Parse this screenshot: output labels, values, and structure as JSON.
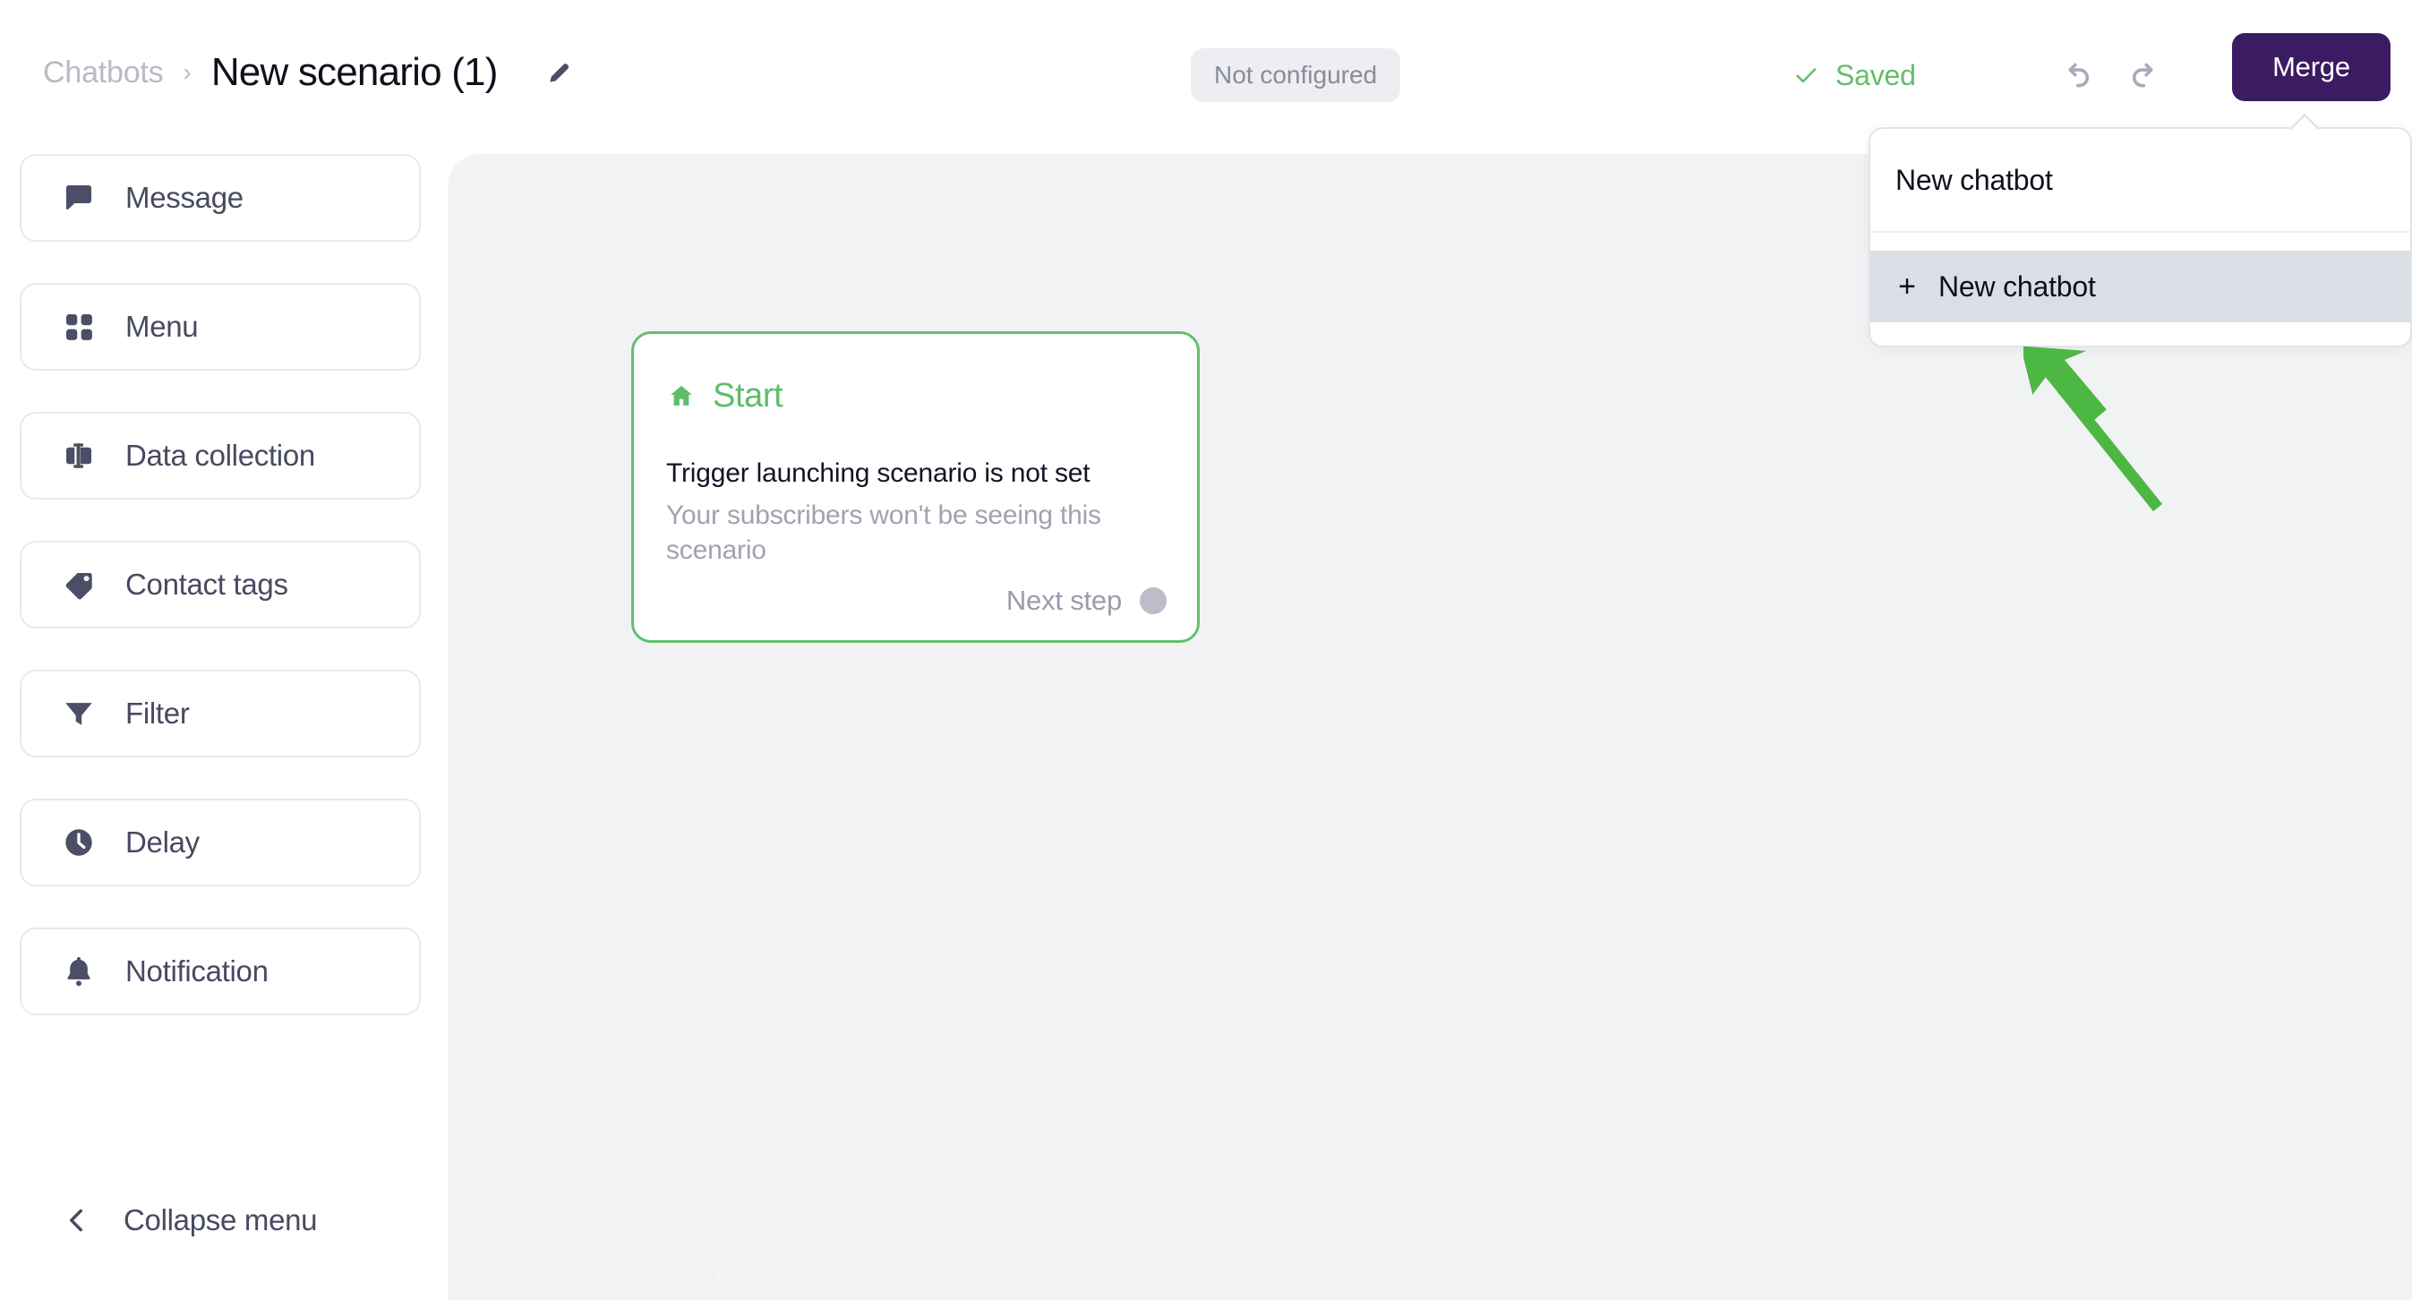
{
  "header": {
    "breadcrumb_root": "Chatbots",
    "breadcrumb_separator": "›",
    "title": "New scenario (1)",
    "edit_icon": "pencil-icon",
    "status_badge": "Not configured",
    "saved_label": "Saved",
    "saved_color": "#64bd6a",
    "undo_icon": "undo-icon",
    "redo_icon": "redo-icon",
    "merge_label": "Merge",
    "merge_color": "#3b1c63"
  },
  "dropdown": {
    "header_label": "New chatbot",
    "items": [
      {
        "label": "New chatbot",
        "icon": "plus-icon",
        "plus": "+",
        "active": true
      }
    ]
  },
  "annotation": {
    "arrow_color": "#4cb council",
    "arrow_hex": "#4cb742",
    "points_to": "New chatbot"
  },
  "sidebar": {
    "items": [
      {
        "label": "Message",
        "icon": "message-bubble-icon"
      },
      {
        "label": "Menu",
        "icon": "grid-menu-icon"
      },
      {
        "label": "Data collection",
        "icon": "text-input-icon"
      },
      {
        "label": "Contact tags",
        "icon": "tag-icon"
      },
      {
        "label": "Filter",
        "icon": "funnel-icon"
      },
      {
        "label": "Delay",
        "icon": "clock-icon"
      },
      {
        "label": "Notification",
        "icon": "bell-icon"
      }
    ],
    "collapse_label": "Collapse menu",
    "collapse_icon": "chevron-left-icon"
  },
  "canvas": {
    "background": "#f1f2f4",
    "start_node": {
      "title": "Start",
      "icon": "home-icon",
      "title_color": "#5fbd68",
      "border_color": "#65bf6c",
      "body_line_1": "Trigger launching scenario is not set",
      "body_line_2": "Your subscribers won't be seeing this scenario",
      "next_step_label": "Next step",
      "next_step_dot_color": "#bcbdc8"
    }
  }
}
